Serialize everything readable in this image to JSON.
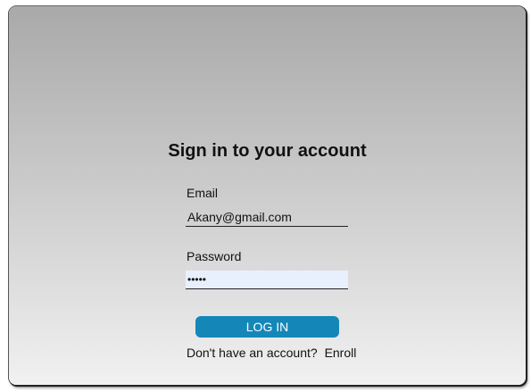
{
  "login": {
    "title": "Sign in to your account",
    "email_label": "Email",
    "email_value": "Akany@gmail.com",
    "password_label": "Password",
    "password_value": "•••••",
    "login_button": "LOG IN",
    "no_account_text": "Don't have an account?",
    "enroll_link": "Enroll"
  },
  "colors": {
    "button_bg": "#1487b8",
    "autofill_bg": "#e8f0fe"
  }
}
